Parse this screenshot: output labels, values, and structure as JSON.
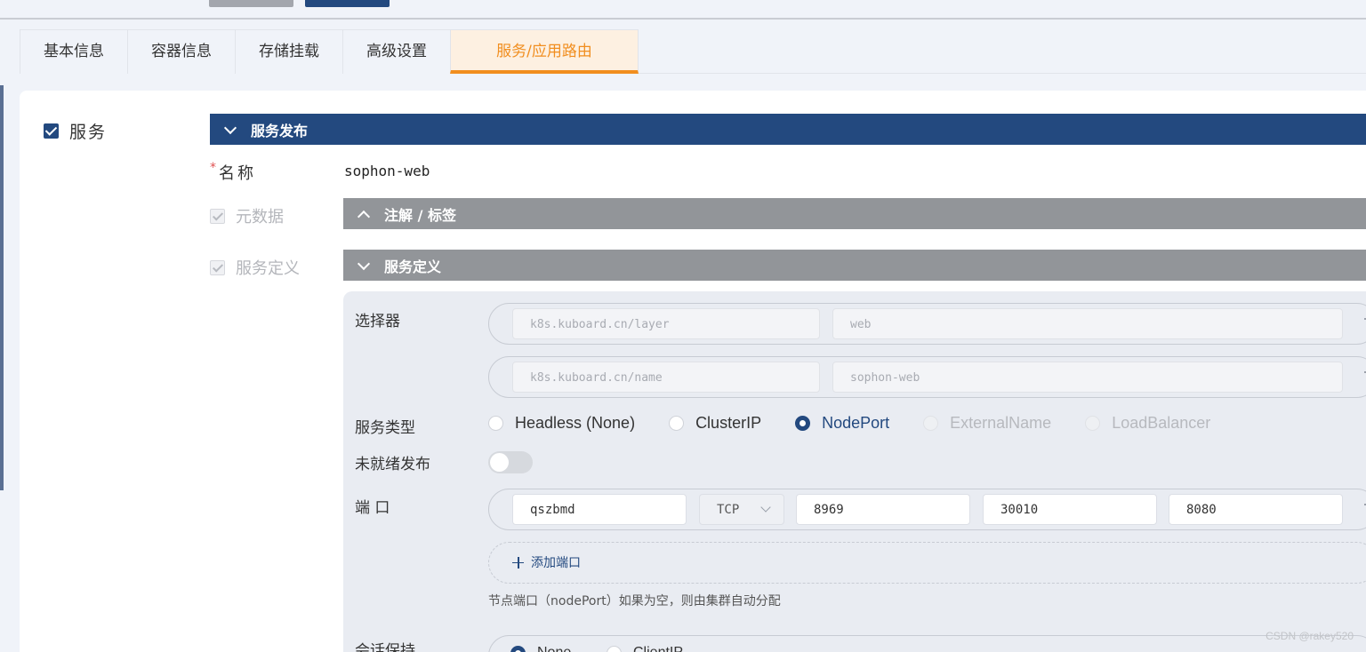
{
  "tabs": [
    {
      "label": "基本信息"
    },
    {
      "label": "容器信息"
    },
    {
      "label": "存储挂载"
    },
    {
      "label": "高级设置"
    },
    {
      "label": "服务/应用路由",
      "active": true
    }
  ],
  "service": {
    "checkbox_label": "服务",
    "checked": true
  },
  "publish_section": {
    "title": "服务发布",
    "name_label": "名称",
    "name_value": "sophon-web",
    "metadata_label": "元数据",
    "annotations_bar": "注解 / 标签",
    "definition_label": "服务定义",
    "definition_bar": "服务定义"
  },
  "definition": {
    "selector_label": "选择器",
    "selectors": [
      {
        "key": "k8s.kuboard.cn/layer",
        "value": "web"
      },
      {
        "key": "k8s.kuboard.cn/name",
        "value": "sophon-web"
      }
    ],
    "service_type_label": "服务类型",
    "service_types": [
      {
        "label": "Headless (None)",
        "state": "off"
      },
      {
        "label": "ClusterIP",
        "state": "off"
      },
      {
        "label": "NodePort",
        "state": "on"
      },
      {
        "label": "ExternalName",
        "state": "disabled"
      },
      {
        "label": "LoadBalancer",
        "state": "disabled"
      }
    ],
    "unready_label": "未就绪发布",
    "unready_enabled": false,
    "port_label": "端 口",
    "port": {
      "name": "qszbmd",
      "protocol": "TCP",
      "port": "8969",
      "node_port": "30010",
      "target_port": "8080"
    },
    "add_port_label": "添加端口",
    "node_port_hint": "节点端口（nodePort）如果为空，则由集群自动分配",
    "session_label": "会话保持",
    "session_options": [
      {
        "label": "None",
        "state": "on"
      },
      {
        "label": "ClientIP",
        "state": "off"
      }
    ]
  },
  "watermark": "CSDN @rakey520",
  "colors": {
    "primary": "#23497f",
    "active_tab": "#f18e1f",
    "section_bar": "#929599"
  }
}
